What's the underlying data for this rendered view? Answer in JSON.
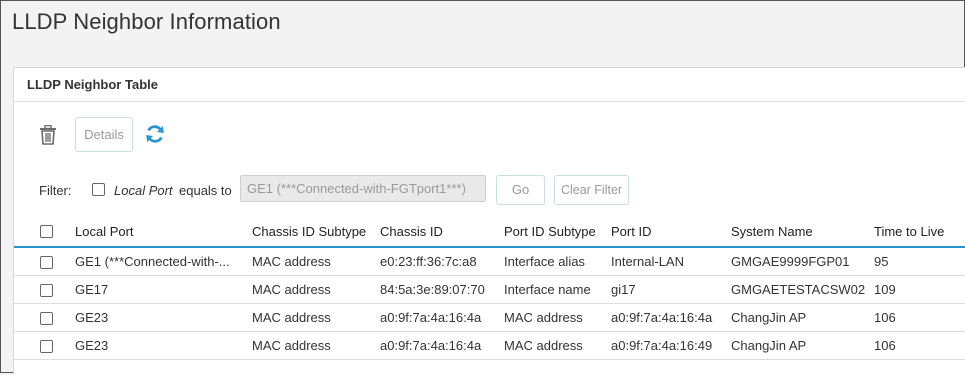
{
  "page": {
    "title": "LLDP Neighbor Information"
  },
  "panel": {
    "title": "LLDP Neighbor Table"
  },
  "toolbar": {
    "details_label": "Details"
  },
  "filter": {
    "label": "Filter:",
    "field": "Local Port",
    "operator": "equals to",
    "value": "GE1 (***Connected-with-FGTport1***)",
    "go_label": "Go",
    "clear_label": "Clear Filter"
  },
  "table": {
    "columns": [
      "Local Port",
      "Chassis ID Subtype",
      "Chassis ID",
      "Port ID Subtype",
      "Port ID",
      "System Name",
      "Time to Live"
    ],
    "rows": [
      [
        "GE1 (***Connected-with-...",
        "MAC address",
        "e0:23:ff:36:7c:a8",
        "Interface alias",
        "Internal-LAN",
        "GMGAE9999FGP01",
        "95"
      ],
      [
        "GE17",
        "MAC address",
        "84:5a:3e:89:07:70",
        "Interface name",
        "gi17",
        "GMGAETESTACSW02",
        "109"
      ],
      [
        "GE23",
        "MAC address",
        "a0:9f:7a:4a:16:4a",
        "MAC address",
        "a0:9f:7a:4a:16:4a",
        "ChangJin AP",
        "106"
      ],
      [
        "GE23",
        "MAC address",
        "a0:9f:7a:4a:16:4a",
        "MAC address",
        "a0:9f:7a:4a:16:49",
        "ChangJin AP",
        "106"
      ]
    ]
  },
  "colors": {
    "accent": "#2a94cf",
    "icon_gray": "#6b6b6b"
  },
  "icons": {
    "delete": "trash-icon",
    "refresh": "refresh-icon"
  }
}
